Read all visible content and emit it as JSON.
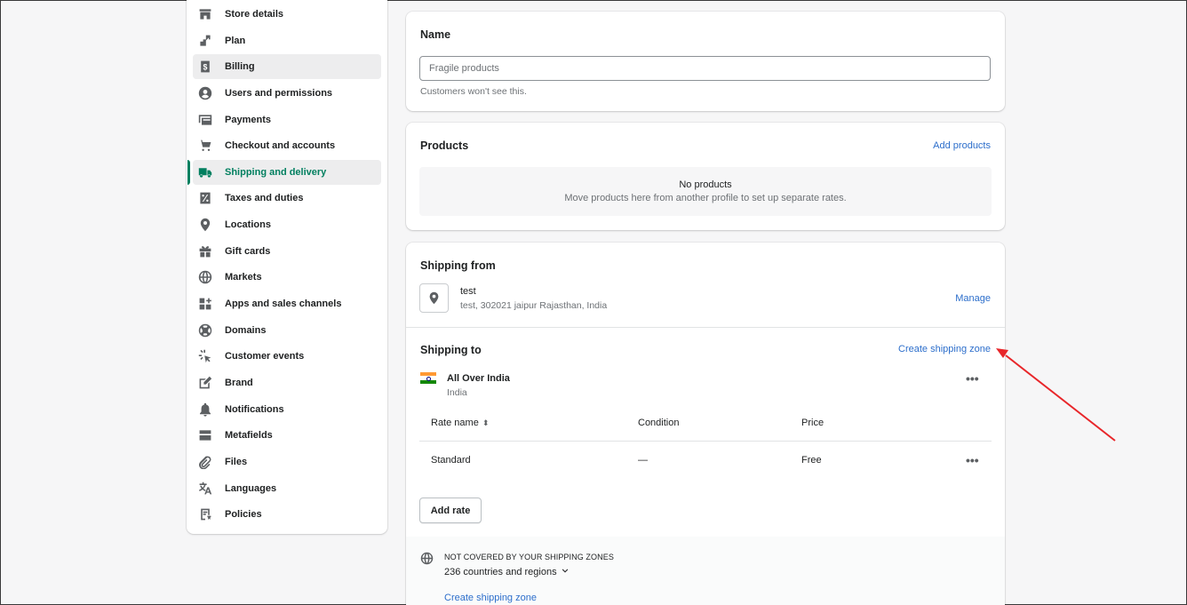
{
  "sidebar": {
    "items": [
      {
        "label": "Store details",
        "icon": "store-icon"
      },
      {
        "label": "Plan",
        "icon": "plan-icon"
      },
      {
        "label": "Billing",
        "icon": "billing-icon"
      },
      {
        "label": "Users and permissions",
        "icon": "user-icon"
      },
      {
        "label": "Payments",
        "icon": "payments-icon"
      },
      {
        "label": "Checkout and accounts",
        "icon": "cart-icon"
      },
      {
        "label": "Shipping and delivery",
        "icon": "truck-icon"
      },
      {
        "label": "Taxes and duties",
        "icon": "tax-icon"
      },
      {
        "label": "Locations",
        "icon": "location-icon"
      },
      {
        "label": "Gift cards",
        "icon": "gift-icon"
      },
      {
        "label": "Markets",
        "icon": "globe-icon"
      },
      {
        "label": "Apps and sales channels",
        "icon": "apps-icon"
      },
      {
        "label": "Domains",
        "icon": "domains-icon"
      },
      {
        "label": "Customer events",
        "icon": "cursor-click-icon"
      },
      {
        "label": "Brand",
        "icon": "brand-icon"
      },
      {
        "label": "Notifications",
        "icon": "bell-icon"
      },
      {
        "label": "Metafields",
        "icon": "metafields-icon"
      },
      {
        "label": "Files",
        "icon": "paperclip-icon"
      },
      {
        "label": "Languages",
        "icon": "translate-icon"
      },
      {
        "label": "Policies",
        "icon": "policies-icon"
      }
    ],
    "active_item": "Shipping and delivery",
    "hover_item": "Billing",
    "accent_color": "#008060"
  },
  "name_card": {
    "title": "Name",
    "input_value": "Fragile products",
    "help_text": "Customers won't see this."
  },
  "products_card": {
    "title": "Products",
    "add_link": "Add products",
    "empty_title": "No products",
    "empty_text": "Move products here from another profile to set up separate rates."
  },
  "shipping_card": {
    "from_title": "Shipping from",
    "location_name": "test",
    "location_address": "test, 302021 jaipur Rajasthan, India",
    "manage_link": "Manage",
    "to_title": "Shipping to",
    "create_zone_link": "Create shipping zone",
    "zone": {
      "name": "All Over India",
      "country": "India",
      "more_label": "•••"
    },
    "table": {
      "headers": [
        "Rate name",
        "Condition",
        "Price"
      ],
      "rows": [
        {
          "rate_name": "Standard",
          "condition": "—",
          "price": "Free",
          "more": "•••"
        }
      ]
    },
    "add_rate_button": "Add rate",
    "not_covered": {
      "title": "NOT COVERED BY YOUR SHIPPING ZONES",
      "count": "236 countries and regions",
      "link": "Create shipping zone"
    }
  },
  "annotation": {
    "arrow_color": "#e8262a"
  },
  "link_color": "#2c6ecb"
}
